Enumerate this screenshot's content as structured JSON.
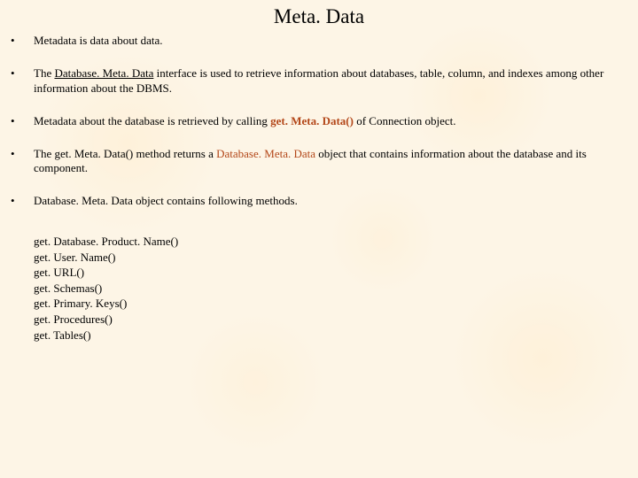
{
  "title": "Meta. Data",
  "bullets": [
    {
      "parts": [
        {
          "text": "Metadata is data about data.",
          "cls": ""
        }
      ]
    },
    {
      "parts": [
        {
          "text": "The ",
          "cls": ""
        },
        {
          "text": "Database. Meta. Data",
          "cls": "underline"
        },
        {
          "text": " interface  is used to  retrieve information about databases, table, column, and indexes among other information about the DBMS.",
          "cls": ""
        }
      ]
    },
    {
      "parts": [
        {
          "text": "Metadata about the database is retrieved by calling ",
          "cls": ""
        },
        {
          "text": "get. Meta. Data() ",
          "cls": "colored bold"
        },
        {
          "text": "of Connection object.",
          "cls": ""
        }
      ]
    },
    {
      "parts": [
        {
          "text": "The get. Meta. Data() method returns a ",
          "cls": ""
        },
        {
          "text": "Database. Meta. Data",
          "cls": "colored"
        },
        {
          "text": " object that contains information about the database and its component.",
          "cls": ""
        }
      ]
    },
    {
      "parts": [
        {
          "text": "Database. Meta. Data object contains following methods.",
          "cls": ""
        }
      ]
    }
  ],
  "methods": [
    "get. Database. Product. Name()",
    "get. User. Name()",
    "get. URL()",
    "get. Schemas()",
    "get. Primary. Keys()",
    "get. Procedures()",
    "get. Tables()"
  ],
  "bullet_char": "•"
}
